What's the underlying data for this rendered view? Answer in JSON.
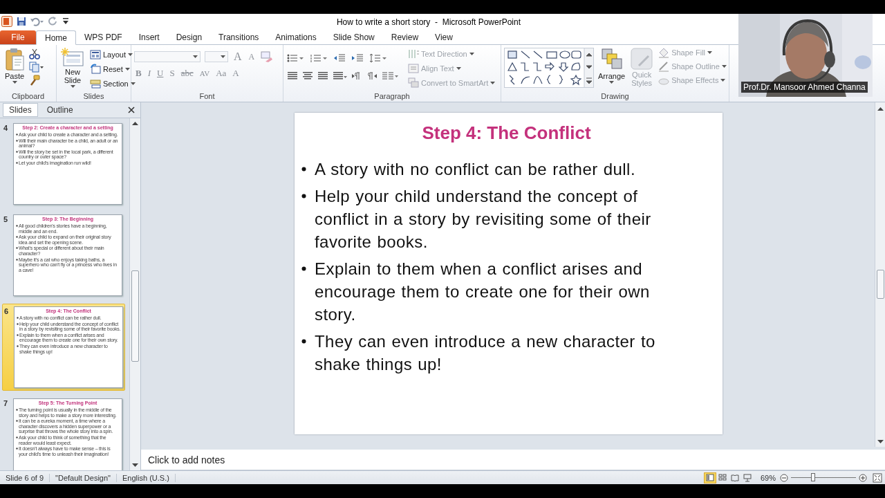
{
  "window": {
    "title": "How to write a short story  -  Microsoft PowerPoint"
  },
  "tabs": [
    {
      "label": "File",
      "kind": "file",
      "selected": false
    },
    {
      "label": "Home",
      "kind": "tab",
      "selected": true
    },
    {
      "label": "WPS PDF",
      "kind": "tab",
      "selected": false
    },
    {
      "label": "Insert",
      "kind": "tab",
      "selected": false
    },
    {
      "label": "Design",
      "kind": "tab",
      "selected": false
    },
    {
      "label": "Transitions",
      "kind": "tab",
      "selected": false
    },
    {
      "label": "Animations",
      "kind": "tab",
      "selected": false
    },
    {
      "label": "Slide Show",
      "kind": "tab",
      "selected": false
    },
    {
      "label": "Review",
      "kind": "tab",
      "selected": false
    },
    {
      "label": "View",
      "kind": "tab",
      "selected": false
    }
  ],
  "ribbon": {
    "clipboard": {
      "label": "Clipboard",
      "paste": "Paste"
    },
    "slides": {
      "label": "Slides",
      "new_slide": "New Slide",
      "commands": [
        {
          "label": "Layout",
          "kind": "layout",
          "disabled": false
        },
        {
          "label": "Reset",
          "kind": "reset",
          "disabled": false
        },
        {
          "label": "Section",
          "kind": "section",
          "disabled": false
        }
      ]
    },
    "font": {
      "label": "Font",
      "size_buttons": [
        "A",
        "A"
      ],
      "buttons": [
        "B",
        "I",
        "U",
        "S",
        "abc",
        "AV",
        "Aa",
        "A"
      ]
    },
    "paragraph": {
      "label": "Paragraph",
      "commands": [
        {
          "label": "Text Direction",
          "disabled": true
        },
        {
          "label": "Align Text",
          "disabled": true
        },
        {
          "label": "Convert to SmartArt",
          "disabled": true
        }
      ]
    },
    "drawing": {
      "label": "Drawing",
      "arrange": "Arrange",
      "quick_styles": "Quick Styles",
      "quick_styles_disabled": true,
      "commands": [
        {
          "label": "Shape Fill",
          "kind": "fill",
          "disabled": true
        },
        {
          "label": "Shape Outline",
          "kind": "outline",
          "disabled": true
        },
        {
          "label": "Shape Effects",
          "kind": "effects",
          "disabled": true
        }
      ]
    }
  },
  "webcam": {
    "caption": "Prof.Dr. Mansoor Ahmed Channa"
  },
  "slides_panel": {
    "tabs": [
      {
        "label": "Slides",
        "selected": true
      },
      {
        "label": "Outline",
        "selected": false
      }
    ],
    "thumbnails": [
      {
        "number": "4",
        "selected": false,
        "title": "Step 2: Create a character and a setting",
        "bullets": [
          "Ask your child to create a character and a setting.",
          "Will their main character be a child, an adult or an animal?",
          "Will the story be set in the local park, a different country or outer space?",
          "Let your child's imagination run wild!"
        ]
      },
      {
        "number": "5",
        "selected": false,
        "title": "Step 3: The Beginning",
        "bullets": [
          "All good children's stories have a beginning, middle and an end.",
          "Ask your child to expand on their original story idea and set the opening scene.",
          "What's special or different about their main character?",
          "Maybe it's a cat who enjoys taking baths, a superhero who can't fly or a princess who lives in a cave!"
        ]
      },
      {
        "number": "6",
        "selected": true,
        "title": "Step 4: The Conflict",
        "bullets": [
          "A story with no conflict can be rather dull.",
          "Help your child understand the concept of conflict in a story by revisiting some of their favorite books.",
          "Explain to them when a conflict arises and encourage them to create one for their own story.",
          "They can even introduce a new character to shake things up!"
        ]
      },
      {
        "number": "7",
        "selected": false,
        "title": "Step 5: The Turning  Point",
        "bullets": [
          "The turning point is usually in the middle of the story and helps to make a story more interesting.",
          "It can be a eureka moment, a time where a character discovers a hidden superpower or a surprise that throws the whole story into a spin.",
          "Ask your child to think of something that the reader would least expect.",
          "It doesn't always have to make sense – this is your child's time to unleash their imagination!"
        ]
      }
    ]
  },
  "slide": {
    "title": "Step 4: The Conflict",
    "bullets": [
      "A story with no conflict can be rather dull.",
      "Help your child understand the concept of conflict in a story by revisiting some of their favorite books.",
      "Explain to them when a conflict arises and encourage them to create one for their own story.",
      "They can even introduce a new character to shake things up!"
    ]
  },
  "notes": {
    "placeholder": "Click to add notes"
  },
  "status_bar": {
    "items": [
      "Slide 6 of 9",
      "\"Default Design\"",
      "English (U.S.)"
    ],
    "views": [
      {
        "kind": "normal",
        "selected": true
      },
      {
        "kind": "sorter",
        "selected": false
      },
      {
        "kind": "reading",
        "selected": false
      },
      {
        "kind": "slideshow",
        "selected": false
      }
    ],
    "zoom": "69%",
    "zoom_slider": {
      "level": 0.34
    }
  }
}
